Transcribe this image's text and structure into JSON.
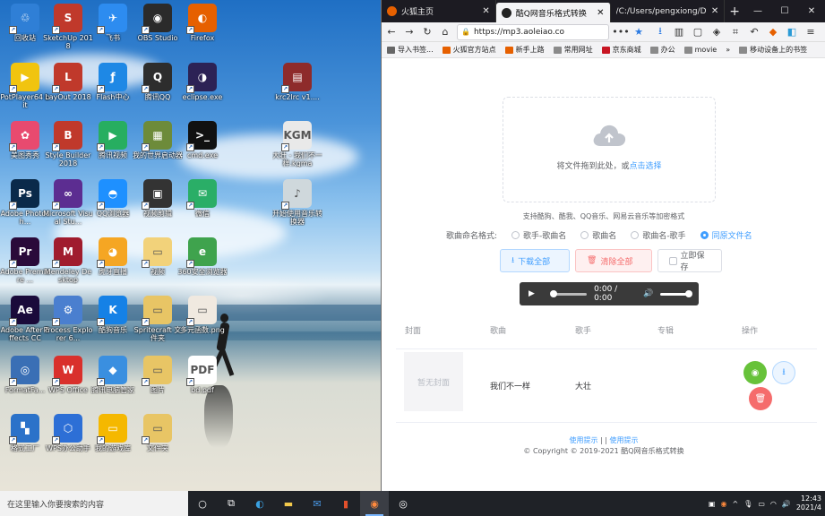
{
  "desktop": {
    "icons": [
      {
        "label": "回收站",
        "color": "#2f7fd6",
        "glyph": "♲"
      },
      {
        "label": "SketchUp 2018",
        "color": "#c0392b",
        "glyph": "S"
      },
      {
        "label": "飞书",
        "color": "#2d8cf0",
        "glyph": "✈"
      },
      {
        "label": "OBS Studio",
        "color": "#2b2b2b",
        "glyph": "◉"
      },
      {
        "label": "Firefox",
        "color": "#e66000",
        "glyph": "◐"
      },
      {
        "label": "PotPlayer64 bit",
        "color": "#f1c40f",
        "glyph": "▶"
      },
      {
        "label": "LayOut 2018",
        "color": "#c0392b",
        "glyph": "L"
      },
      {
        "label": "Flash中心",
        "color": "#1e88e5",
        "glyph": "ƒ"
      },
      {
        "label": "腾讯QQ",
        "color": "#2d2d2d",
        "glyph": "Q"
      },
      {
        "label": "eclipse.exe",
        "color": "#2c2255",
        "glyph": "◑"
      },
      {
        "label": "krc2lrc v1....",
        "color": "#8e2b2b",
        "glyph": "▤"
      },
      {
        "label": "美图秀秀",
        "color": "#e84a6f",
        "glyph": "✿"
      },
      {
        "label": "Style Builder 2018",
        "color": "#c0392b",
        "glyph": "B"
      },
      {
        "label": "腾讯视频",
        "color": "#27ae60",
        "glyph": "▶"
      },
      {
        "label": "我的世界启动器",
        "color": "#6d8b3a",
        "glyph": "▦"
      },
      {
        "label": "cmd.exe",
        "color": "#111111",
        "glyph": ">_"
      },
      {
        "label": "大壮 - 我们不一样.kgma",
        "color": "#e9e9e9",
        "glyph": "KGM"
      },
      {
        "label": "Adobe Photosh...",
        "color": "#0a2a4a",
        "glyph": "Ps"
      },
      {
        "label": "Microsoft Visual Stu...",
        "color": "#5c2d91",
        "glyph": "∞"
      },
      {
        "label": "QQ浏览器",
        "color": "#1e90ff",
        "glyph": "◓"
      },
      {
        "label": "视频剪辑",
        "color": "#333333",
        "glyph": "▣"
      },
      {
        "label": "微信",
        "color": "#2aae67",
        "glyph": "✉"
      },
      {
        "label": "开始使用音乐转换器",
        "color": "#cfd8dc",
        "glyph": "♪"
      },
      {
        "label": "Adobe Premiere ...",
        "color": "#2a0a3a",
        "glyph": "Pr"
      },
      {
        "label": "Mendeley Desktop",
        "color": "#a01c2e",
        "glyph": "M"
      },
      {
        "label": "虎牙直播",
        "color": "#f5a623",
        "glyph": "◕"
      },
      {
        "label": "视频",
        "color": "#f2d27a",
        "glyph": "▭"
      },
      {
        "label": "360安全浏览器",
        "color": "#3fa34d",
        "glyph": "e"
      },
      {
        "label": "Adobe After Effects CC",
        "color": "#1a0a3a",
        "glyph": "Ae"
      },
      {
        "label": "Process Explorer 6...",
        "color": "#4a7fcf",
        "glyph": "⚙"
      },
      {
        "label": "酷狗音乐",
        "color": "#1581e6",
        "glyph": "K"
      },
      {
        "label": "Spritecraft 文件夹",
        "color": "#e8c565",
        "glyph": "▭"
      },
      {
        "label": "多元函数.png",
        "color": "#f0e9e0",
        "glyph": "▭"
      },
      {
        "label": "FormatFa...",
        "color": "#3a6fb5",
        "glyph": "◎"
      },
      {
        "label": "WPS Office",
        "color": "#d9302c",
        "glyph": "W"
      },
      {
        "label": "腾讯电脑管家",
        "color": "#3a8fe0",
        "glyph": "◆"
      },
      {
        "label": "图片",
        "color": "#e8c565",
        "glyph": "▭"
      },
      {
        "label": "bd.pdf",
        "color": "#ffffff",
        "glyph": "PDF"
      },
      {
        "label": "格式工厂",
        "color": "#2b72c9",
        "glyph": "▚"
      },
      {
        "label": "WPS办公助手",
        "color": "#2d6fd6",
        "glyph": "⬡"
      },
      {
        "label": "我的游戏库",
        "color": "#f5b800",
        "glyph": "▭"
      },
      {
        "label": "文件夹",
        "color": "#e8c565",
        "glyph": "▭"
      }
    ]
  },
  "browser": {
    "tabs": [
      {
        "title": "火狐主页",
        "fav_color": "#e66000",
        "active": false
      },
      {
        "title": "酷Q网音乐格式转换",
        "fav_color": "#222222",
        "active": true
      },
      {
        "title": "/C:/Users/pengxiong/D",
        "fav_color": "#666666",
        "active": false
      }
    ],
    "new_tab": "+",
    "window_controls": [
      "—",
      "☐",
      "✕"
    ],
    "nav": {
      "back": "←",
      "forward": "→",
      "reload": "↻",
      "home": "⌂"
    },
    "url": "https://mp3.aoleiao.co",
    "url_more": "•••",
    "bookmarks": [
      {
        "label": "导入书签...",
        "color": "#666666"
      },
      {
        "label": "火狐官方站点",
        "color": "#e66000"
      },
      {
        "label": "新手上路",
        "color": "#e66000"
      },
      {
        "label": "常用网址",
        "color": "#8a8a8a"
      },
      {
        "label": "京东商城",
        "color": "#c81623"
      },
      {
        "label": "办公",
        "color": "#8a8a8a"
      },
      {
        "label": "movie",
        "color": "#8a8a8a"
      },
      {
        "label": "移动设备上的书签",
        "color": "#8a8a8a"
      }
    ],
    "bookmark_more": "»"
  },
  "page": {
    "drop_hint_prefix": "将文件拖到此处，或",
    "drop_hint_link": "点击选择",
    "support_text": "支持酷狗、酷我、QQ音乐、网易云音乐等加密格式",
    "naming_label": "歌曲命名格式:",
    "naming_options": [
      {
        "label": "歌手-歌曲名",
        "selected": false
      },
      {
        "label": "歌曲名",
        "selected": false
      },
      {
        "label": "歌曲名-歌手",
        "selected": false
      },
      {
        "label": "同原文件名",
        "selected": true
      }
    ],
    "buttons": {
      "download_all": "下载全部",
      "clear_all": "清除全部",
      "save_now": "立即保存"
    },
    "player": {
      "time": "0:00 / 0:00"
    },
    "table": {
      "headers": [
        "封面",
        "歌曲",
        "歌手",
        "专辑",
        "操作"
      ],
      "rows": [
        {
          "cover": "暂无封面",
          "song": "我们不一样",
          "artist": "大壮",
          "album": ""
        }
      ]
    },
    "footer": {
      "link1": "使用提示",
      "sep": "|",
      "link2": "使用提示",
      "copyright": "© Copyright © 2019-2021 酷Q网音乐格式转换"
    }
  },
  "taskbar": {
    "search_placeholder": "在这里输入你要搜索的内容",
    "clock_time": "12:43",
    "clock_date": "2021/4"
  }
}
